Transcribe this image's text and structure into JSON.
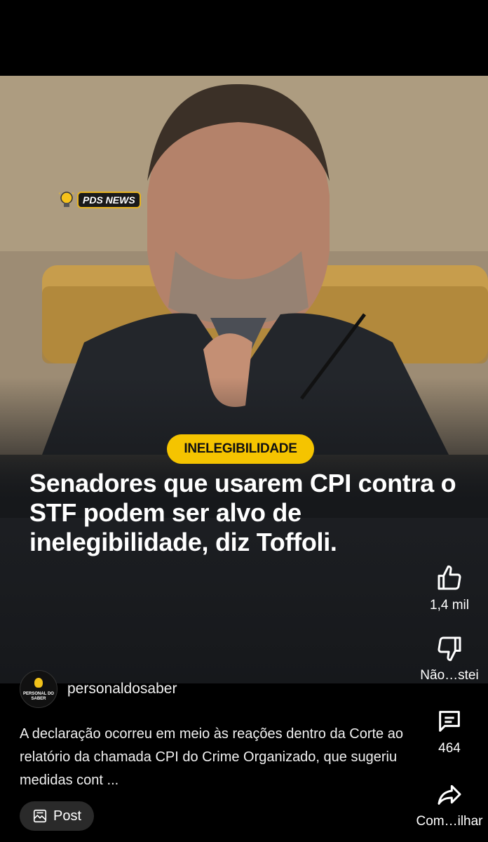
{
  "post": {
    "logo_text": "PDS NEWS",
    "badge": "INELEGIBILIDADE",
    "headline": "Senadores que usarem CPI contra o STF podem ser alvo de inelegibilidade, diz Toffoli."
  },
  "actions": {
    "like_count": "1,4 mil",
    "dislike_label": "Não…stei",
    "comment_count": "464",
    "share_label": "Com…ilhar"
  },
  "channel": {
    "name": "personaldosaber",
    "avatar_text": "PERSONAL DO SABER"
  },
  "description": "A declaração ocorreu em meio às reações dentro da Corte ao relatório da chamada CPI do Crime Organizado, que sugeriu medidas cont ...",
  "post_button": {
    "label": "Post"
  },
  "colors": {
    "badge": "#f5c400",
    "background": "#000000"
  }
}
